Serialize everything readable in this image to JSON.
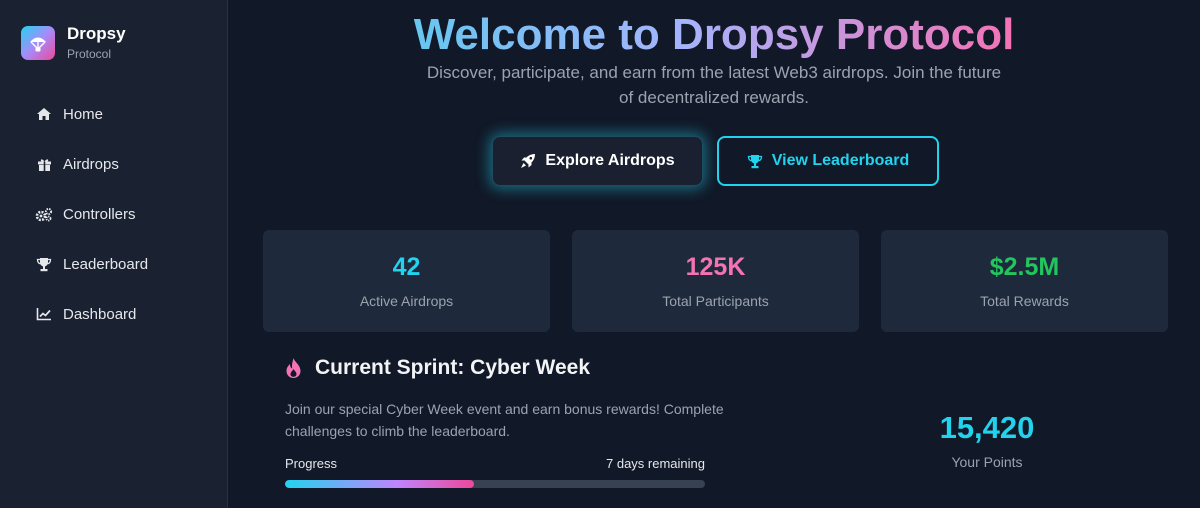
{
  "brand": {
    "name": "Dropsy",
    "subtitle": "Protocol",
    "logo_icon": "parachute-icon"
  },
  "sidebar": {
    "items": [
      {
        "label": "Home",
        "icon": "home-icon"
      },
      {
        "label": "Airdrops",
        "icon": "gift-icon"
      },
      {
        "label": "Controllers",
        "icon": "cogs-icon"
      },
      {
        "label": "Leaderboard",
        "icon": "trophy-icon"
      },
      {
        "label": "Dashboard",
        "icon": "chart-line-icon"
      }
    ]
  },
  "hero": {
    "title": "Welcome to Dropsy Protocol",
    "subtitle": "Discover, participate, and earn from the latest Web3 airdrops. Join the future of decentralized rewards."
  },
  "actions": {
    "explore_label": "Explore Airdrops",
    "leaderboard_label": "View Leaderboard"
  },
  "stats": [
    {
      "value": "42",
      "label": "Active Airdrops",
      "color": "#22d3ee"
    },
    {
      "value": "125K",
      "label": "Total Participants",
      "color": "#f472b6"
    },
    {
      "value": "$2.5M",
      "label": "Total Rewards",
      "color": "#22c55e"
    }
  ],
  "sprint": {
    "title": "Current Sprint: Cyber Week",
    "description": "Join our special Cyber Week event and earn bonus rewards! Complete challenges to climb the leaderboard.",
    "progress_label": "Progress",
    "remaining": "7 days remaining",
    "progress_fraction": 0.45,
    "points_value": "15,420",
    "points_label": "Your Points"
  },
  "colors": {
    "accent_cyan": "#22d3ee",
    "accent_pink": "#f472b6",
    "accent_green": "#22c55e",
    "background": "#111827",
    "sidebar": "#1a2232"
  }
}
